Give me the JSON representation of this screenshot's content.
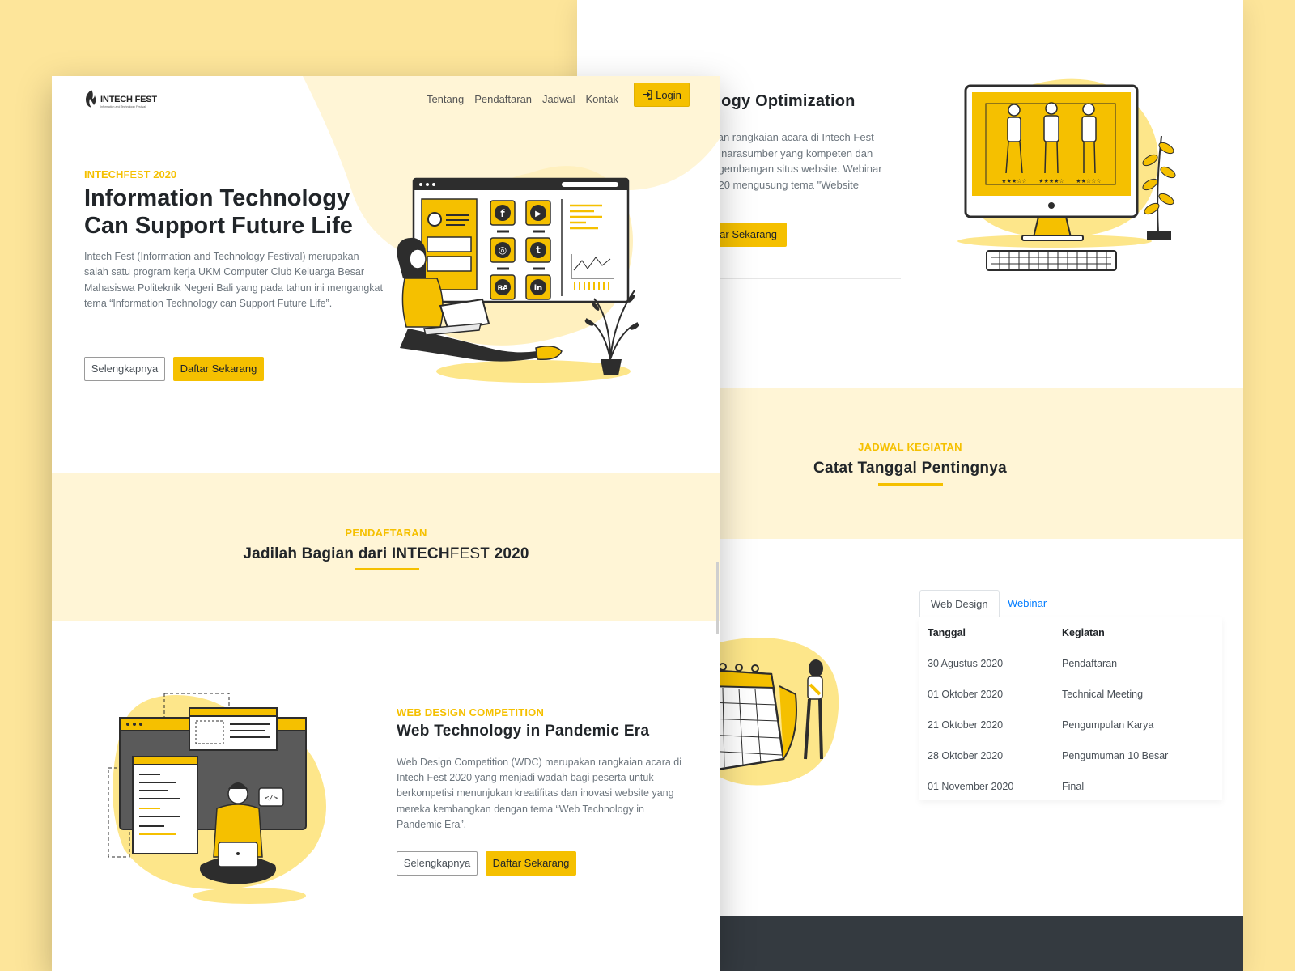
{
  "back": {
    "title_fragment": "ology Optimization",
    "desc_lines": [
      "akan rangkaian acara di Intech Fest",
      "ng narasumber yang kompeten dan",
      "engembangan situs website. Webinar",
      "2020 mengusung tema \"Website",
      "n\""
    ],
    "button_fragment": "tar Sekarang",
    "schedule_eyebrow": "JADWAL KEGIATAN",
    "schedule_heading": "Catat Tanggal Pentingnya",
    "tabs": [
      "Web Design",
      "Webinar"
    ],
    "table_headers": [
      "Tanggal",
      "Kegiatan"
    ],
    "table_rows": [
      [
        "30 Agustus 2020",
        "Pendaftaran"
      ],
      [
        "01 Oktober 2020",
        "Technical Meeting"
      ],
      [
        "21 Oktober 2020",
        "Pengumpulan Karya"
      ],
      [
        "28 Oktober 2020",
        "Pengumuman 10 Besar"
      ],
      [
        "01 November 2020",
        "Final"
      ]
    ]
  },
  "front": {
    "logo_text": "INTECH FEST",
    "logo_subtext": "Information and Technology Festival",
    "nav": [
      "Tentang",
      "Pendaftaran",
      "Jadwal",
      "Kontak"
    ],
    "login_label": "Login",
    "hero": {
      "eyebrow_bold": "INTECH",
      "eyebrow_thin": "FEST",
      "eyebrow_year": " 2020",
      "title": "Information Technology Can Support Future Life",
      "description": "Intech Fest (Information and Technology Festival) merupakan salah satu program kerja UKM Computer Club Keluarga Besar Mahasiswa Politeknik Negeri Bali yang pada tahun ini mengangkat tema “Information Technology can Support Future Life”.",
      "btn_more": "Selengkapnya",
      "btn_register": "Daftar Sekarang"
    },
    "registration": {
      "eyebrow": "PENDAFTARAN",
      "heading_part1": "Jadilah Bagian dari INTECH",
      "heading_thin": "FEST",
      "heading_part2": " 2020"
    },
    "wdc": {
      "eyebrow": "WEB DESIGN COMPETITION",
      "title": "Web Technology in Pandemic Era",
      "description": "Web Design Competition (WDC) merupakan rangkaian acara di Intech Fest 2020 yang menjadi wadah bagi peserta untuk berkompetisi menunjukan kreatifitas dan inovasi website yang mereka kembangkan dengan tema “Web Technology in Pandemic Era”.",
      "btn_more": "Selengkapnya",
      "btn_register": "Daftar Sekarang"
    },
    "social_icons": [
      "facebook",
      "youtube",
      "instagram",
      "twitter",
      "behance",
      "linkedin"
    ],
    "social_glyphs": [
      "f",
      "▶",
      "◎",
      "t",
      "Bē",
      "in"
    ]
  },
  "colors": {
    "page_bg": "#fde59a",
    "accent": "#f5c000",
    "band": "#fff5d6",
    "dark": "#343a40"
  }
}
